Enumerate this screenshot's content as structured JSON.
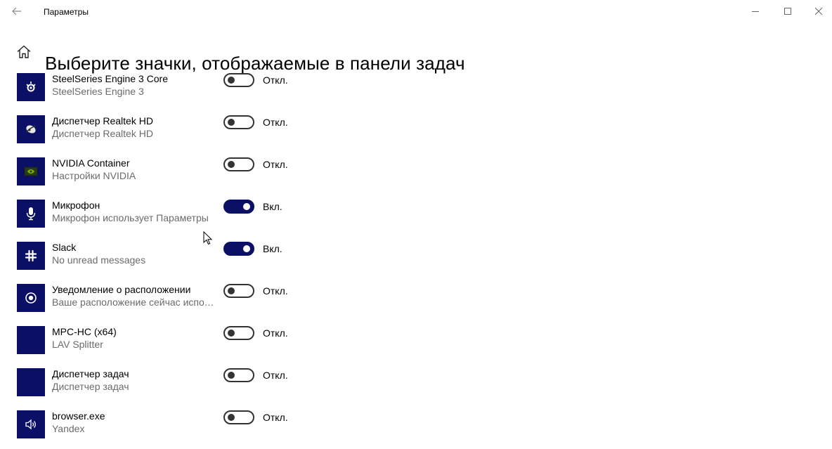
{
  "window": {
    "title": "Параметры",
    "back_icon": "back-arrow-icon",
    "controls": [
      "minimize-icon",
      "maximize-icon",
      "close-icon"
    ]
  },
  "page": {
    "title": "Выберите значки, отображаемые в панели задач",
    "home_icon": "home-icon"
  },
  "accent_color": "#0b0f66",
  "items": [
    {
      "name": "SteelSeries Engine 3 Core",
      "subtitle": "SteelSeries Engine 3",
      "state": "Откл.",
      "on": false,
      "icon": "steelseries-icon"
    },
    {
      "name": "Диспетчер Realtek HD",
      "subtitle": "Диспетчер Realtek HD",
      "state": "Откл.",
      "on": false,
      "icon": "realtek-icon"
    },
    {
      "name": "NVIDIA Container",
      "subtitle": "Настройки NVIDIA",
      "state": "Откл.",
      "on": false,
      "icon": "nvidia-icon"
    },
    {
      "name": "Микрофон",
      "subtitle": "Микрофон использует Параметры",
      "state": "Вкл.",
      "on": true,
      "icon": "microphone-icon"
    },
    {
      "name": "Slack",
      "subtitle": "No unread messages",
      "state": "Вкл.",
      "on": true,
      "icon": "slack-icon"
    },
    {
      "name": "Уведомление о расположении",
      "subtitle": "Ваше расположение сейчас испол...",
      "state": "Откл.",
      "on": false,
      "icon": "location-icon"
    },
    {
      "name": "MPC-HC (x64)",
      "subtitle": "LAV Splitter",
      "state": "Откл.",
      "on": false,
      "icon": "mpc-hc-icon"
    },
    {
      "name": "Диспетчер задач",
      "subtitle": "Диспетчер задач",
      "state": "Откл.",
      "on": false,
      "icon": "task-manager-icon"
    },
    {
      "name": "browser.exe",
      "subtitle": "Yandex",
      "state": "Откл.",
      "on": false,
      "icon": "speaker-icon"
    }
  ]
}
